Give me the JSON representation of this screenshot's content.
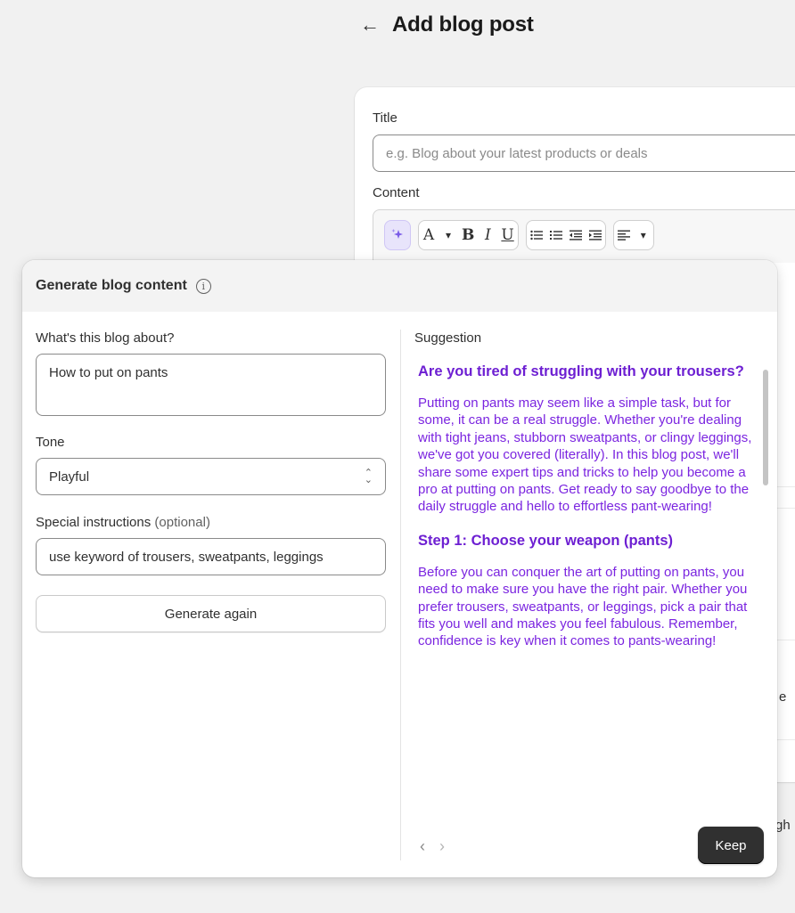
{
  "header": {
    "back_icon": "arrow-left-icon",
    "title": "Add blog post"
  },
  "editor": {
    "title_label": "Title",
    "title_placeholder": "e.g. Blog about your latest products or deals",
    "content_label": "Content",
    "toolbar": {
      "ai_icon": "sparkle-magic-icon",
      "font_button": "A",
      "chevron": "⌄",
      "bold": "B",
      "italic": "I",
      "underline": "U",
      "bullet_list": "☰",
      "numbered_list": "☷",
      "outdent": "⇤",
      "indent": "⇥",
      "align": "≡"
    },
    "partial_text_1": "e",
    "partial_text_2": "gh"
  },
  "dialog": {
    "title": "Generate blog content",
    "info_icon": "info-icon",
    "about_label": "What's this blog about?",
    "about_value": "How to put on pants",
    "tone_label": "Tone",
    "tone_value": "Playful",
    "instructions_label": "Special instructions",
    "instructions_optional": "(optional)",
    "instructions_value": "use keyword of trousers, sweatpants, leggings",
    "generate_again_label": "Generate again",
    "suggestion_label": "Suggestion",
    "suggestion": {
      "heading_1": "Are you tired of struggling with your trousers?",
      "paragraph_1": "Putting on pants may seem like a simple task, but for some, it can be a real struggle. Whether you're dealing with tight jeans, stubborn sweatpants, or clingy leggings, we've got you covered (literally). In this blog post, we'll share some expert tips and tricks to help you become a pro at putting on pants. Get ready to say goodbye to the daily struggle and hello to effortless pant-wearing!",
      "heading_2": "Step 1: Choose your weapon (pants)",
      "paragraph_2": "Before you can conquer the art of putting on pants, you need to make sure you have the right pair. Whether you prefer trousers, sweatpants, or leggings, pick a pair that fits you well and makes you feel fabulous. Remember, confidence is key when it comes to pants-wearing!"
    },
    "prev_icon": "‹",
    "next_icon": "›",
    "keep_label": "Keep"
  },
  "colors": {
    "page_bg": "#f1f1f1",
    "suggestion_text": "#7b25e0",
    "suggestion_heading": "#6d1fd2",
    "primary_button": "#303030"
  }
}
